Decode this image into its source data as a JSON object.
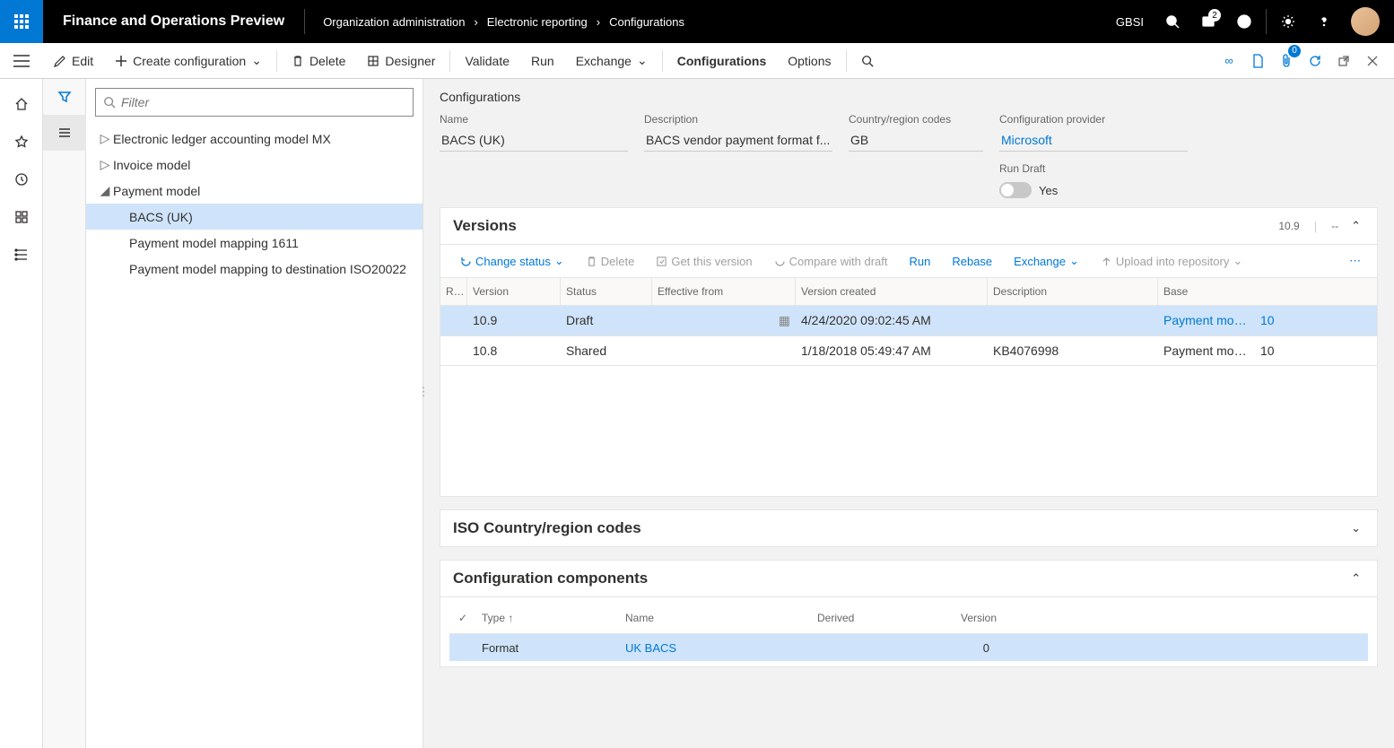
{
  "app_title": "Finance and Operations Preview",
  "breadcrumb": [
    "Organization administration",
    "Electronic reporting",
    "Configurations"
  ],
  "company": "GBSI",
  "notification_count": "2",
  "attach_count": "0",
  "commands": {
    "edit": "Edit",
    "create": "Create configuration",
    "delete": "Delete",
    "designer": "Designer",
    "validate": "Validate",
    "run": "Run",
    "exchange": "Exchange",
    "configurations": "Configurations",
    "options": "Options"
  },
  "filter_placeholder": "Filter",
  "tree": [
    {
      "label": "Electronic ledger accounting model MX",
      "level": 0,
      "expanded": false
    },
    {
      "label": "Invoice model",
      "level": 0,
      "expanded": false
    },
    {
      "label": "Payment model",
      "level": 0,
      "expanded": true
    },
    {
      "label": "BACS (UK)",
      "level": 1,
      "selected": true
    },
    {
      "label": "Payment model mapping 1611",
      "level": 1
    },
    {
      "label": "Payment model mapping to destination ISO20022",
      "level": 1
    }
  ],
  "details": {
    "section": "Configurations",
    "name_label": "Name",
    "name": "BACS (UK)",
    "desc_label": "Description",
    "desc": "BACS vendor payment format f...",
    "country_label": "Country/region codes",
    "country": "GB",
    "provider_label": "Configuration provider",
    "provider": "Microsoft",
    "rundraft_label": "Run Draft",
    "rundraft_val": "Yes"
  },
  "versions": {
    "title": "Versions",
    "meta1": "10.9",
    "meta2": "--",
    "toolbar": {
      "change": "Change status",
      "delete": "Delete",
      "get": "Get this version",
      "compare": "Compare with draft",
      "run": "Run",
      "rebase": "Rebase",
      "exchange": "Exchange",
      "upload": "Upload into repository"
    },
    "columns": {
      "r": "R...",
      "ver": "Version",
      "stat": "Status",
      "eff": "Effective from",
      "created": "Version created",
      "desc": "Description",
      "base": "Base"
    },
    "rows": [
      {
        "ver": "10.9",
        "stat": "Draft",
        "eff_icon": true,
        "created": "4/24/2020 09:02:45 AM",
        "desc": "",
        "base": "Payment model",
        "basev": "10",
        "sel": true,
        "base_link": true
      },
      {
        "ver": "10.8",
        "stat": "Shared",
        "created": "1/18/2018 05:49:47 AM",
        "desc": "KB4076998",
        "base": "Payment model",
        "basev": "10"
      }
    ]
  },
  "iso_section": "ISO Country/region codes",
  "components": {
    "title": "Configuration components",
    "columns": {
      "type": "Type",
      "name": "Name",
      "derived": "Derived",
      "version": "Version"
    },
    "rows": [
      {
        "type": "Format",
        "name": "UK BACS",
        "derived": "",
        "version": "0",
        "sel": true
      }
    ]
  }
}
